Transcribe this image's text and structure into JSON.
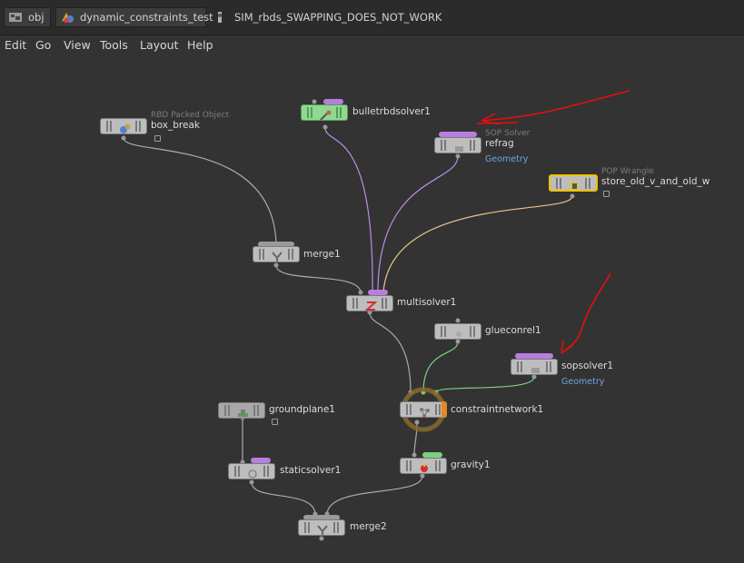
{
  "path": {
    "crumbs": [
      "obj",
      "dynamic_constraints_test"
    ],
    "current": "SIM_rbds_SWAPPING_DOES_NOT_WORK"
  },
  "menu": [
    "Edit",
    "Go",
    "View",
    "Tools",
    "Layout",
    "Help"
  ],
  "nodes": {
    "box_break": {
      "name": "box_break",
      "type": "RBD Packed Object"
    },
    "bulletrbdsolver1": {
      "name": "bulletrbdsolver1"
    },
    "refrag": {
      "name": "refrag",
      "type": "SOP Solver",
      "data": "Geometry"
    },
    "store_old": {
      "name": "store_old_v_and_old_w",
      "type": "POP Wrangle"
    },
    "merge1": {
      "name": "merge1"
    },
    "multisolver1": {
      "name": "multisolver1"
    },
    "glueconrel1": {
      "name": "glueconrel1"
    },
    "sopsolver1": {
      "name": "sopsolver1",
      "data": "Geometry"
    },
    "constraintnetwork1": {
      "name": "constraintnetwork1"
    },
    "groundplane1": {
      "name": "groundplane1"
    },
    "staticsolver1": {
      "name": "staticsolver1"
    },
    "gravity1": {
      "name": "gravity1"
    },
    "merge2": {
      "name": "merge2"
    }
  },
  "colors": {
    "background": "#333333",
    "solver_tag": "#b77ee0",
    "green_tag": "#7ed07e",
    "selected_outline": "#f0c000",
    "annotation_arrow": "#e01010",
    "wire_default": "#aaaaaa",
    "wire_purple": "#b98ee6",
    "wire_orange": "#e8c48a",
    "wire_green": "#7fd07f"
  },
  "icons": [
    "obj-icon",
    "dop-network-icon",
    "dop-icon",
    "rbd-packed-icon",
    "bullet-solver-icon",
    "sop-solver-icon",
    "pop-wrangle-icon",
    "merge-icon",
    "multisolver-icon",
    "glue-constraint-icon",
    "constraint-network-icon",
    "groundplane-icon",
    "static-solver-icon",
    "gravity-icon",
    "lock-icon"
  ]
}
